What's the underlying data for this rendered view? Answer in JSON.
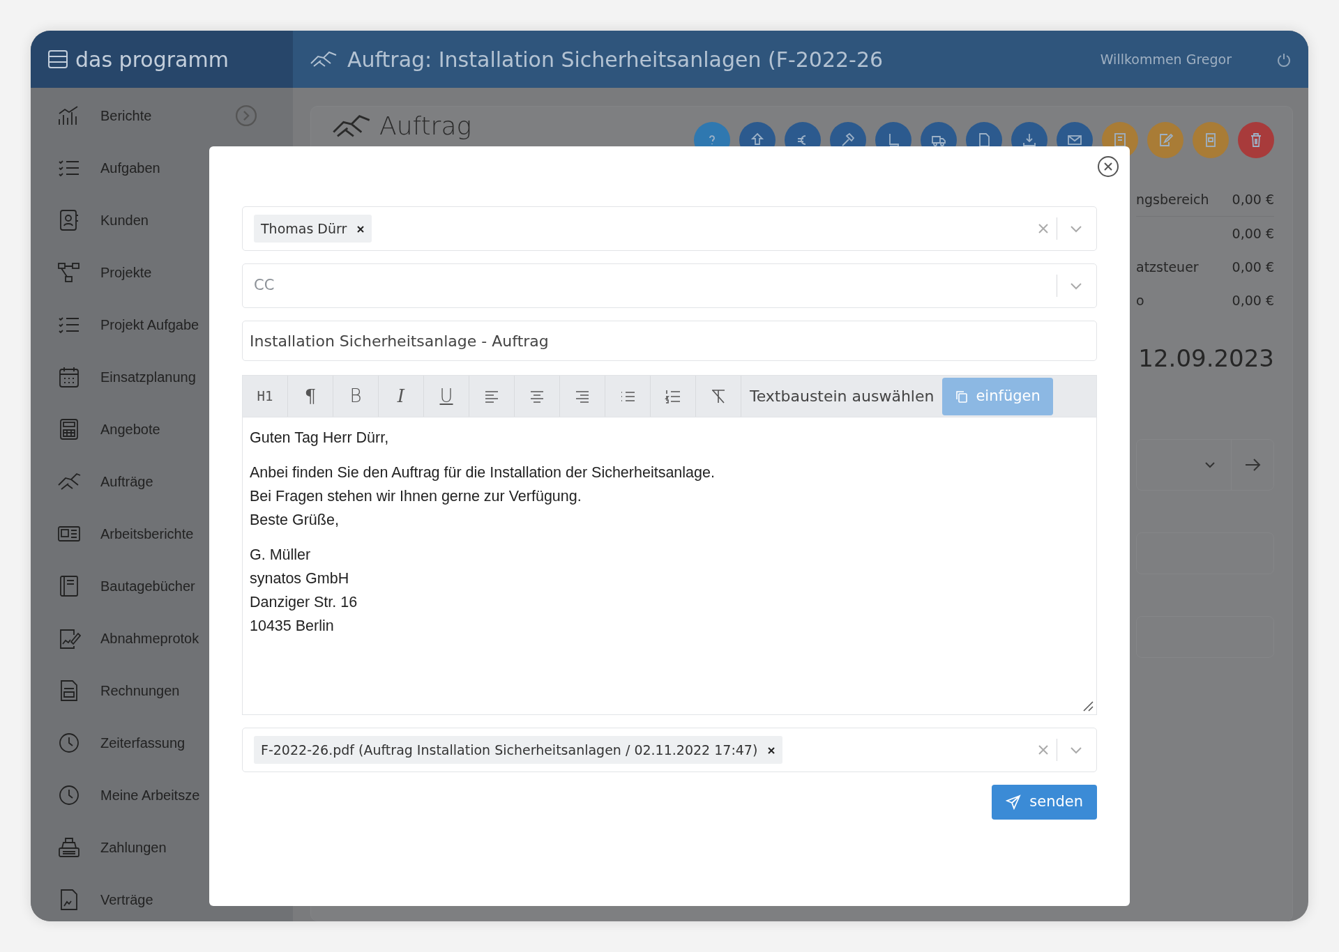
{
  "app": {
    "name": "das programm"
  },
  "header": {
    "title": "Auftrag: Installation Sicherheitsanlagen (F-2022-26",
    "welcome": "Willkommen Gregor"
  },
  "sidebar": {
    "items": [
      {
        "label": "Berichte",
        "kind": "group"
      },
      {
        "label": "Aufgaben",
        "kind": "link"
      },
      {
        "label": "Kunden",
        "kind": "link"
      },
      {
        "label": "Projekte",
        "kind": "link"
      },
      {
        "label": "Projekt Aufgabe",
        "kind": "link"
      },
      {
        "label": "Einsatzplanung",
        "kind": "link"
      },
      {
        "label": "Angebote",
        "kind": "link"
      },
      {
        "label": "Aufträge",
        "kind": "link"
      },
      {
        "label": "Arbeitsberichte",
        "kind": "link"
      },
      {
        "label": "Bautagebücher",
        "kind": "link"
      },
      {
        "label": "Abnahmeprotok",
        "kind": "link"
      },
      {
        "label": "Rechnungen",
        "kind": "link"
      },
      {
        "label": "Zeiterfassung",
        "kind": "link"
      },
      {
        "label": "Meine Arbeitsze",
        "kind": "link"
      },
      {
        "label": "Zahlungen",
        "kind": "link"
      },
      {
        "label": "Verträge",
        "kind": "link"
      }
    ]
  },
  "page": {
    "title": "Auftrag",
    "actions": [
      {
        "color": "#2f78b0"
      },
      {
        "color": "#2c5a8e"
      },
      {
        "color": "#2c5a8e"
      },
      {
        "color": "#2c5a8e"
      },
      {
        "color": "#2c5a8e"
      },
      {
        "color": "#2c5a8e"
      },
      {
        "color": "#2c5a8e"
      },
      {
        "color": "#2c5a8e"
      },
      {
        "color": "#2c5a8e"
      },
      {
        "color": "#a97c36"
      },
      {
        "color": "#a97c36"
      },
      {
        "color": "#a97c36"
      },
      {
        "color": "#a83b3b"
      }
    ],
    "summary": [
      {
        "label": "ngsbereich",
        "value": "0,00 €"
      },
      {
        "value": "0,00 €"
      },
      {
        "label": "atzsteuer",
        "value": "0,00 €"
      },
      {
        "label": "o",
        "value": "0,00 €"
      }
    ],
    "date": "12.09.2023"
  },
  "modal": {
    "to": {
      "chips": [
        "Thomas Dürr"
      ]
    },
    "cc": {
      "placeholder": "CC"
    },
    "subject": {
      "value": "Installation Sicherheitsanlage - Auftrag"
    },
    "toolbar": [
      {
        "kind": "heading",
        "label": "H1"
      },
      {
        "kind": "paragraph",
        "label": "¶"
      },
      {
        "kind": "bold",
        "label": "B"
      },
      {
        "kind": "italic",
        "label": "I"
      },
      {
        "kind": "underline",
        "label": "U"
      },
      {
        "kind": "align-left"
      },
      {
        "kind": "align-center"
      },
      {
        "kind": "align-right"
      },
      {
        "kind": "bullet-list"
      },
      {
        "kind": "numbered-list"
      },
      {
        "kind": "clear-format"
      }
    ],
    "snippet": {
      "placeholder": "Textbaustein auswählen"
    },
    "insert_button": {
      "label": "einfügen",
      "disabled": true
    },
    "body": [
      [
        "Guten Tag Herr Dürr,"
      ],
      [
        "Anbei finden Sie den Auftrag für die Installation der Sicherheitsanlage.",
        "Bei Fragen stehen wir Ihnen gerne zur Verfügung.",
        "Beste Grüße,"
      ],
      [
        "G. Müller",
        "synatos GmbH",
        "Danziger Str. 16",
        "10435 Berlin"
      ]
    ],
    "attachments": {
      "chips": [
        "F-2022-26.pdf (Auftrag Installation Sicherheitsanlagen / 02.11.2022 17:47)"
      ]
    },
    "send_button": {
      "label": "senden"
    }
  }
}
